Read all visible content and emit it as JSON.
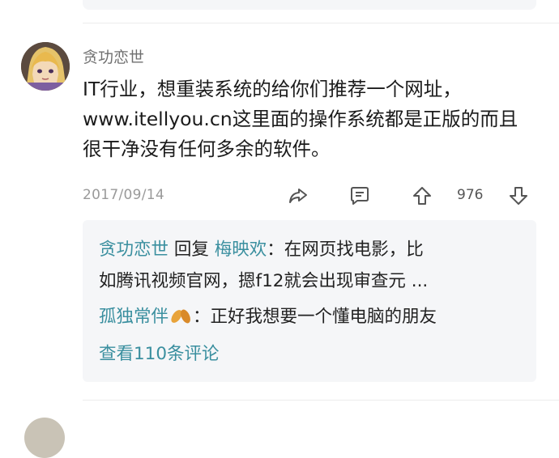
{
  "comment": {
    "username": "贪功恋世",
    "body": "IT行业，想重装系统的给你们推荐一个网址，www.itellyou.cn这里面的操作系统都是正版的而且很干净没有任何多余的软件。",
    "date": "2017/09/14",
    "like_count": "976",
    "icons": [
      "share-icon",
      "comment-icon",
      "upvote-icon",
      "downvote-icon"
    ]
  },
  "replies": [
    {
      "author": "贪功恋世",
      "reply_word": "回复",
      "target": "梅映欢",
      "separator": "：",
      "text": "在网页找电影，比",
      "text_cont": "如腾讯视频官网，摁f12就会出现审查元 ..."
    },
    {
      "author": "孤独常伴",
      "separator": "：",
      "text": "正好我想要一个懂电脑的朋友"
    }
  ],
  "view_more": "查看110条评论",
  "colors": {
    "accent": "#3a8f9f",
    "reply_bg": "#f5f6f8",
    "meta": "#9a9a9a"
  }
}
